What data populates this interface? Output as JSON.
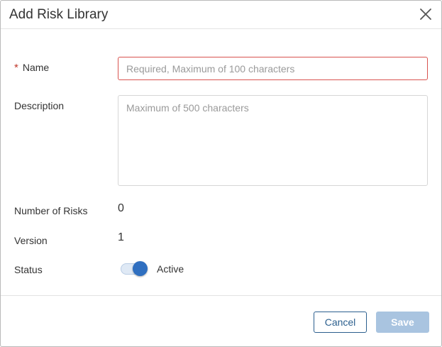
{
  "dialog": {
    "title": "Add Risk Library",
    "close_icon": "close-icon"
  },
  "form": {
    "name": {
      "required_marker": "*",
      "label": "Name",
      "value": "",
      "placeholder": "Required, Maximum of 100 characters"
    },
    "description": {
      "label": "Description",
      "value": "",
      "placeholder": "Maximum of 500 characters"
    },
    "number_of_risks": {
      "label": "Number of Risks",
      "value": "0"
    },
    "version": {
      "label": "Version",
      "value": "1"
    },
    "status": {
      "label": "Status",
      "toggle_on": true,
      "toggle_label": "Active"
    }
  },
  "footer": {
    "cancel_label": "Cancel",
    "save_label": "Save"
  },
  "colors": {
    "accent": "#2f6fc0",
    "error_border": "#d9534f",
    "required_star": "#c0392b",
    "save_disabled": "#a9c4e0",
    "cancel_border": "#2b5f8e"
  }
}
